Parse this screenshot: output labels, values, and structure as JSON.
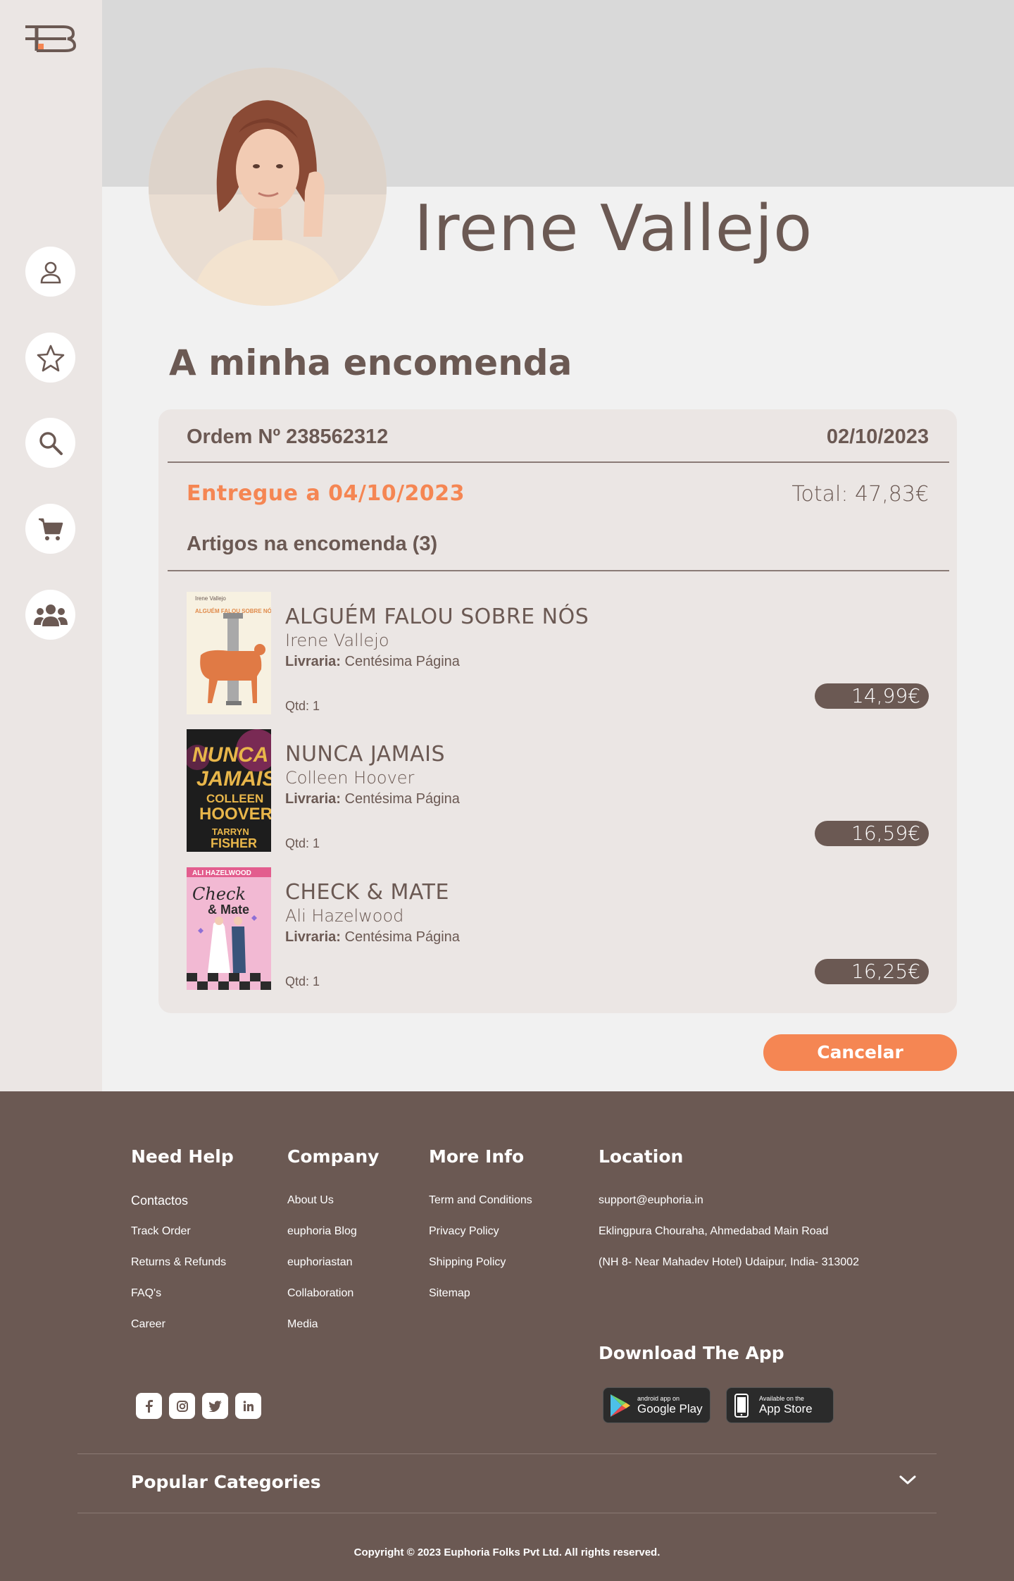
{
  "brand": {
    "logo_icon": "euphoria-logo",
    "accent": "#f58653",
    "primary": "#6b5953"
  },
  "sidebar": {
    "items": [
      {
        "icon": "user-icon"
      },
      {
        "icon": "star-icon"
      },
      {
        "icon": "search-icon"
      },
      {
        "icon": "cart-icon"
      },
      {
        "icon": "group-icon"
      }
    ]
  },
  "profile": {
    "name": "Irene Vallejo"
  },
  "page": {
    "title": "A minha encomenda"
  },
  "order": {
    "number_label": "Ordem Nº 238562312",
    "date": "02/10/2023",
    "delivered": "Entregue a 04/10/2023",
    "total": "Total: 47,83€",
    "items_heading": "Artigos na encomenda (3)",
    "items": [
      {
        "title": "ALGUÉM FALOU SOBRE NÓS",
        "author": "Irene Vallejo",
        "store_label": "Livraria:",
        "store": "Centésima Página",
        "qty": "Qtd: 1",
        "price": "14,99€",
        "cover_author": "Irene Vallejo",
        "cover_title": "ALGUÉM FALOU SOBRE NÓS"
      },
      {
        "title": "NUNCA JAMAIS",
        "author": "Colleen Hoover",
        "store_label": "Livraria:",
        "store": "Centésima Página",
        "qty": "Qtd: 1",
        "price": "16,59€",
        "cover_title_1": "NUNCA",
        "cover_title_2": "JAMAIS",
        "cover_author_1": "COLLEEN",
        "cover_author_2": "HOOVER",
        "cover_author_3": "TARRYN",
        "cover_author_4": "FISHER"
      },
      {
        "title": "CHECK & MATE",
        "author": "Ali Hazelwood",
        "store_label": "Livraria:",
        "store": "Centésima Página",
        "qty": "Qtd: 1",
        "price": "16,25€",
        "cover_author": "ALI HAZELWOOD",
        "cover_title_1": "Check",
        "cover_title_2": "& Mate"
      }
    ],
    "cancel_label": "Cancelar"
  },
  "footer": {
    "columns": [
      {
        "title": "Need Help",
        "links": [
          "Contactos",
          "Track Order",
          "Returns & Refunds",
          "FAQ's",
          "Career"
        ]
      },
      {
        "title": "Company",
        "links": [
          "About Us",
          "euphoria Blog",
          "euphoriastan",
          "Collaboration",
          "Media"
        ]
      },
      {
        "title": "More Info",
        "links": [
          "Term and Conditions",
          "Privacy Policy",
          "Shipping Policy",
          "Sitemap"
        ]
      },
      {
        "title": "Location",
        "links": [
          "support@euphoria.in",
          "Eklingpura Chouraha, Ahmedabad Main Road",
          "(NH 8- Near Mahadev Hotel) Udaipur, India- 313002"
        ]
      }
    ],
    "social": [
      "facebook-icon",
      "instagram-icon",
      "twitter-icon",
      "linkedin-icon"
    ],
    "download_title": "Download The App",
    "google_play": {
      "small": "android app on",
      "big": "Google Play"
    },
    "app_store": {
      "small": "Available on the",
      "big": "App Store"
    },
    "popular_categories": "Popular Categories",
    "copyright": "Copyright © 2023 Euphoria Folks Pvt Ltd. All rights reserved."
  }
}
